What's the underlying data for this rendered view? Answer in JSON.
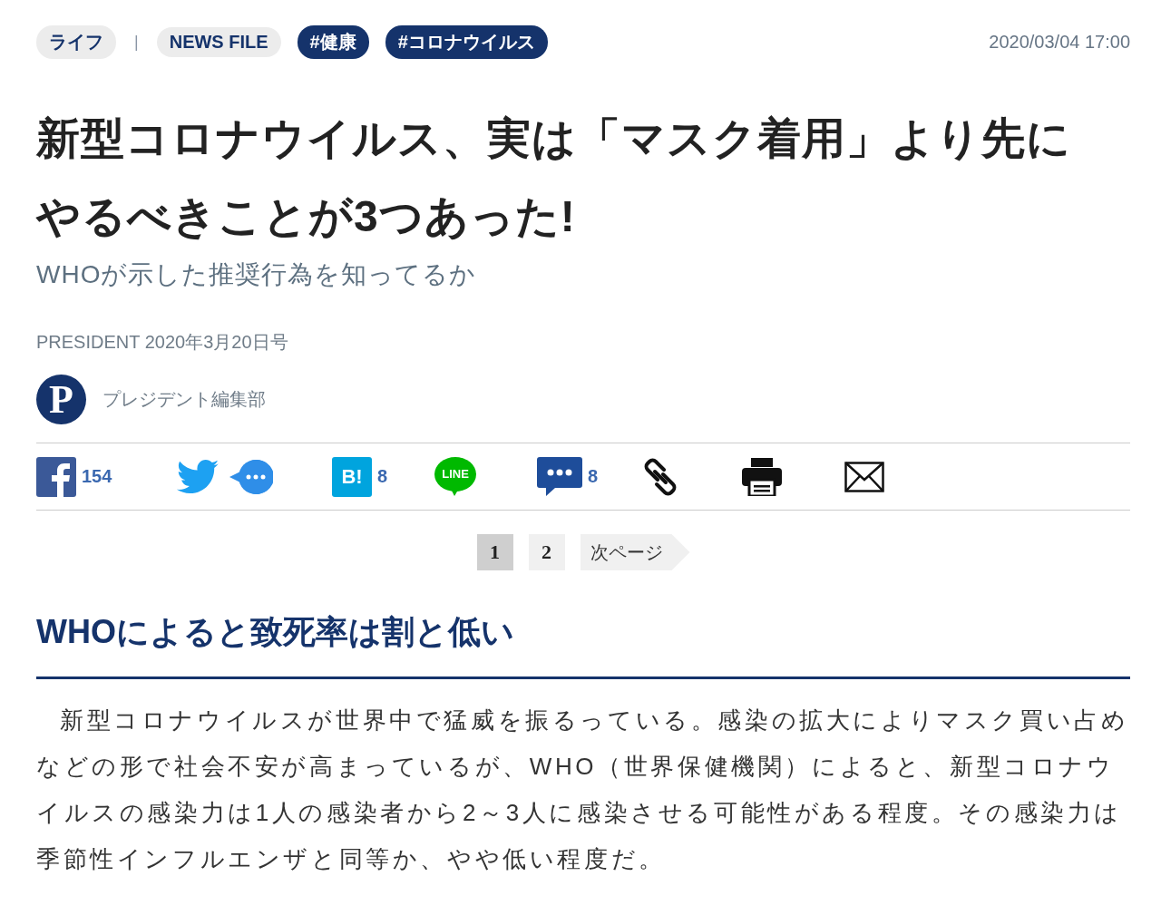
{
  "tags": [
    {
      "label": "ライフ",
      "kind": "category"
    },
    {
      "label": "|",
      "kind": "separator"
    },
    {
      "label": "NEWS FILE",
      "kind": "category"
    },
    {
      "label": "#健康",
      "kind": "hashtag"
    },
    {
      "label": "#コロナウイルス",
      "kind": "hashtag"
    }
  ],
  "date": "2020/03/04 17:00",
  "title": "新型コロナウイルス、実は「マスク着用」より先にやるべきことが3つあった!",
  "subtitle": "WHOが示した推奨行為を知ってるか",
  "publication": "PRESIDENT 2020年3月20日号",
  "author": {
    "logo_letter": "P",
    "name": "プレジデント編集部"
  },
  "share": [
    {
      "kind": "facebook",
      "count": "154"
    },
    {
      "kind": "twitter"
    },
    {
      "kind": "bubble"
    },
    {
      "kind": "hatena",
      "label": "B!",
      "count": "8"
    },
    {
      "kind": "line",
      "label": "LINE"
    },
    {
      "kind": "comment",
      "count": "8"
    },
    {
      "kind": "link"
    },
    {
      "kind": "print"
    },
    {
      "kind": "mail"
    }
  ],
  "pagination": [
    {
      "label": "1",
      "kind": "page",
      "selected": true
    },
    {
      "label": "2",
      "kind": "page",
      "selected": false
    },
    {
      "label": "次ページ",
      "kind": "next",
      "selected": false
    }
  ],
  "section_heading": "WHOによると致死率は割と低い",
  "body": "新型コロナウイルスが世界中で猛威を振るっている。感染の拡大によりマスク買い占めなどの形で社会不安が高まっているが、WHO（世界保健機関）によると、新型コロナウイルスの感染力は1人の感染者から2～3人に感染させる可能性がある程度。その感染力は季節性インフルエンザと同等か、やや低い程度だ。"
}
